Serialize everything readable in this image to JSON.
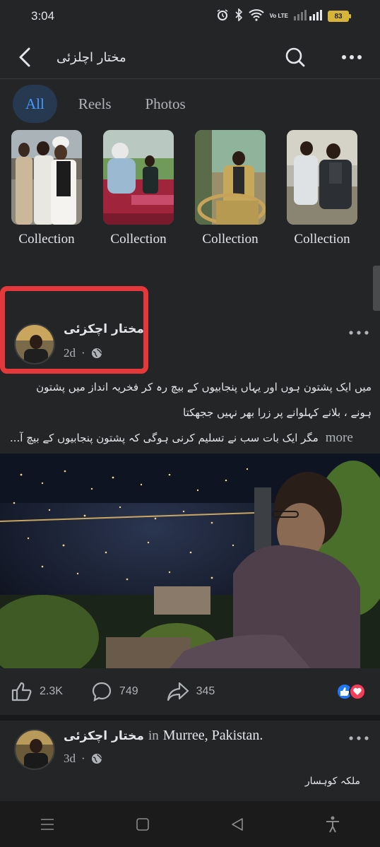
{
  "status_bar": {
    "time": "3:04",
    "battery": "83",
    "network_label": "Vo LTE"
  },
  "header": {
    "title": "مختار اچلزئی"
  },
  "tabs": [
    {
      "label": "All",
      "active": true
    },
    {
      "label": "Reels",
      "active": false
    },
    {
      "label": "Photos",
      "active": false
    }
  ],
  "collections": [
    {
      "label": "Collection"
    },
    {
      "label": "Collection"
    },
    {
      "label": "Collection"
    },
    {
      "label": "Collection"
    }
  ],
  "post1": {
    "author": "مختار اچکزئی",
    "time": "2d",
    "text_line1": "میں ایک پشتون ہوں اور یہاں پنجابیوں کے بیچ رہ کر فخریہ انداز میں پشتون",
    "text_line2": "ہونے ، بلانے کہلوانے پر زرا بھر نہیں ججھکتا",
    "text_line3": "مگر ایک بات سب نے تسلیم کرنی ہوگی کہ پشتون پنجابیوں کے بیچ آ...",
    "more_label": "more",
    "likes": "2.3K",
    "comments": "749",
    "shares": "345"
  },
  "post2": {
    "author": "مختار اچکزئی",
    "in_label": "in",
    "location": "Murree, Pakistan.",
    "time": "3d",
    "text": "ملکہ کوہسار"
  },
  "colors": {
    "background": "#242526",
    "accent": "#4599ff",
    "highlight": "#e5383b"
  }
}
